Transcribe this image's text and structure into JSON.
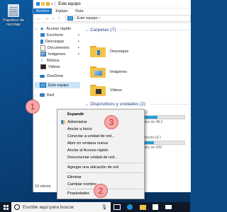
{
  "desktop": {
    "recycle_bin_label": "Papelera de reciclaje"
  },
  "window": {
    "title": "Este equipo",
    "ribbon_tabs": [
      "Archivo",
      "Equipo",
      "Vista"
    ],
    "address": "Este equipo",
    "address_separator": "›"
  },
  "nav": {
    "quick_access": "Acceso rápido",
    "items": [
      {
        "label": "Escritorio"
      },
      {
        "label": "Descargas"
      },
      {
        "label": "Documentos"
      },
      {
        "label": "Imágenes"
      },
      {
        "label": "Música"
      },
      {
        "label": "Videos"
      }
    ],
    "onedrive": "OneDrive",
    "this_pc": "Este equipo",
    "network": "Red"
  },
  "content": {
    "folders_header": "Carpetas (7)",
    "folders": [
      "Descargas",
      "Imágenes",
      "Videos"
    ],
    "devices_header": "Dispositivos y unidades (2)",
    "drive1_fragment": "C:)",
    "drive1_free": "ibles de 48,2",
    "drive2_fragment": "ivbostvi (E:)",
    "drive2_free": "ibles de 439"
  },
  "status": {
    "items_count": "10 eleme"
  },
  "context_menu": {
    "items": [
      {
        "label": "Expandir",
        "bold": true
      },
      {
        "label": "Administrar"
      },
      {
        "label": "Anclar a Inicio"
      },
      {
        "label": "Conectar a unidad de red..."
      },
      {
        "label": "Abrir en ventana nueva"
      },
      {
        "label": "Anclar al Acceso rápido"
      },
      {
        "label": "Desconectar unidad de red..."
      },
      {
        "label": "Agregar una ubicación de red"
      },
      {
        "label": "Eliminar"
      },
      {
        "label": "Cambiar nombre"
      },
      {
        "label": "Propiedades"
      }
    ]
  },
  "annotations": {
    "one": "1",
    "two": "2",
    "three": "3"
  },
  "taskbar": {
    "search_placeholder": "Escribe aquí para buscar"
  },
  "colors": {
    "accent": "#1a73c8",
    "annotation_fill": "#f3a9a9",
    "annotation_text": "#d02424",
    "folder": "#f2c24b",
    "taskbar": "#101828"
  },
  "icons": [
    "recycle-bin-icon",
    "quick-access-star-icon",
    "desktop-icon",
    "downloads-icon",
    "documents-icon",
    "pictures-icon",
    "music-icon",
    "videos-icon",
    "onedrive-icon",
    "this-pc-icon",
    "network-icon",
    "shield-icon",
    "windows-logo-icon",
    "search-icon",
    "mic-icon",
    "task-view-icon",
    "file-explorer-icon",
    "store-icon",
    "mail-icon"
  ]
}
